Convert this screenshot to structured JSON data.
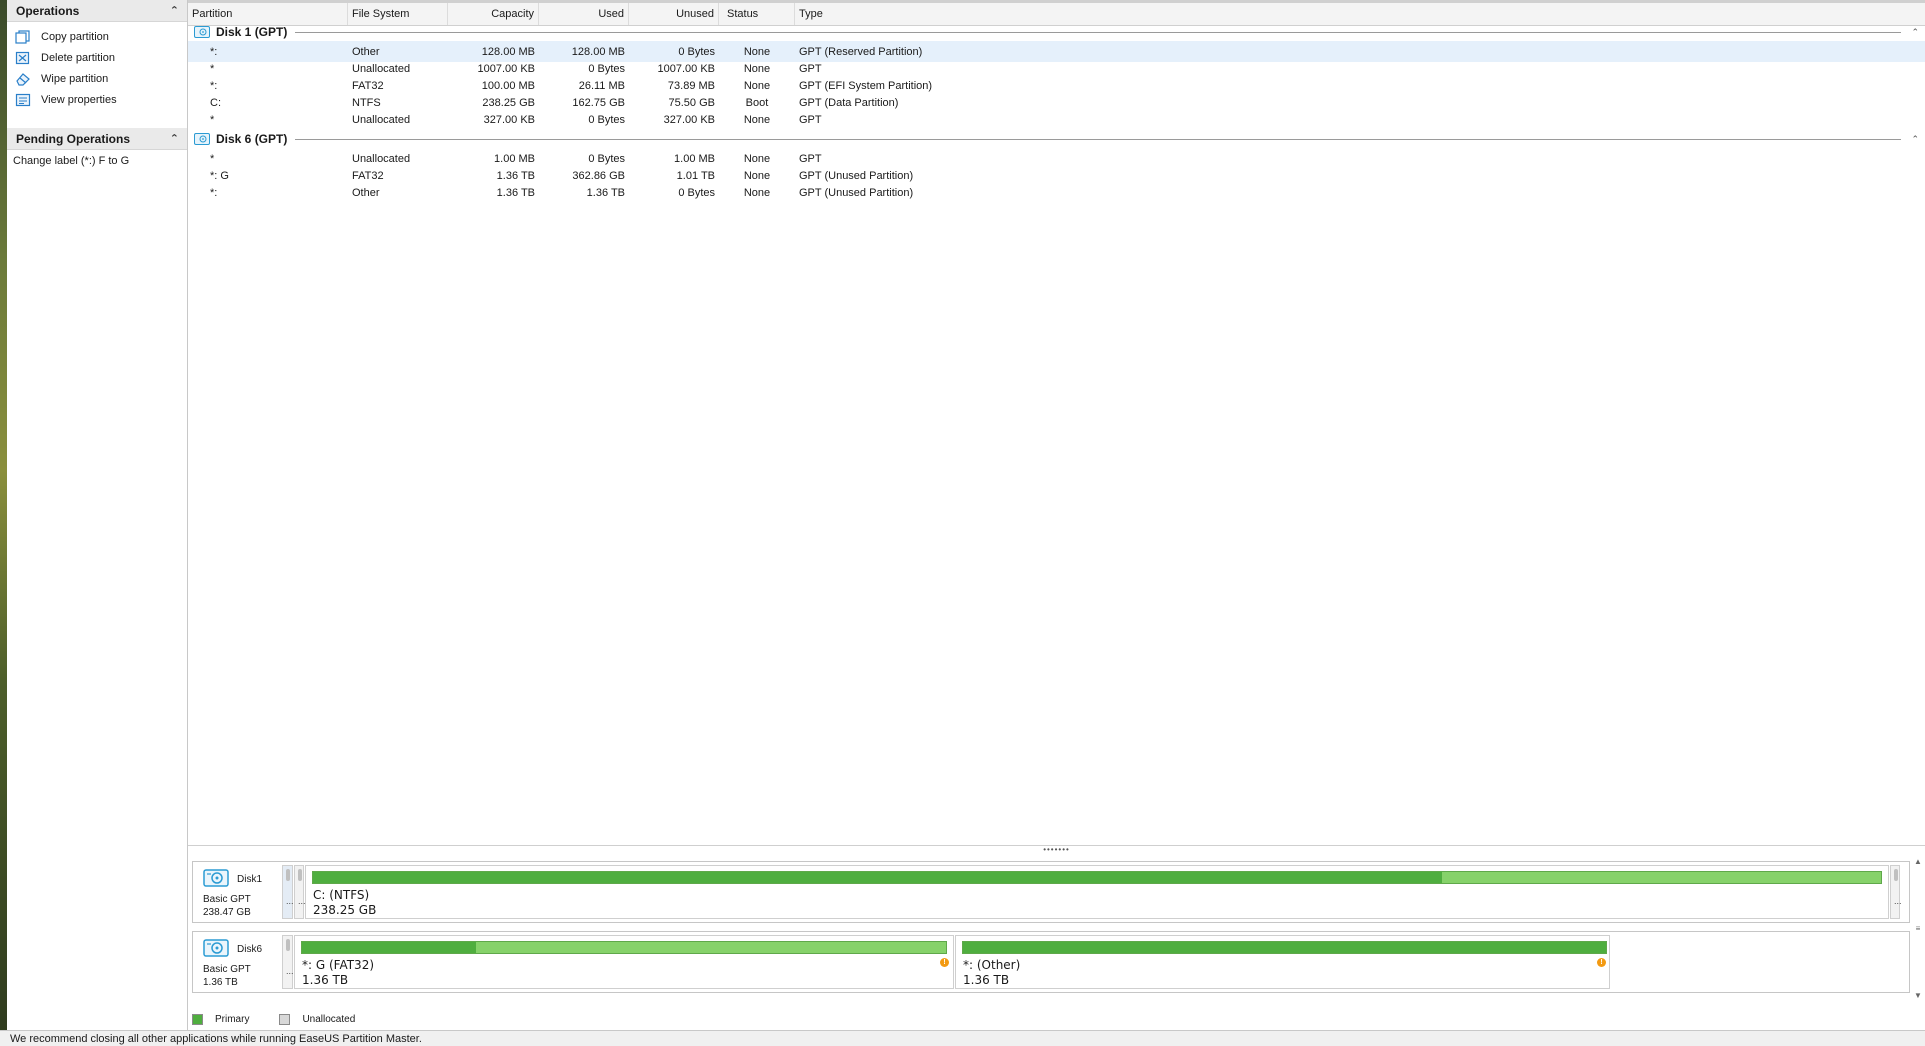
{
  "operations": {
    "title": "Operations",
    "items": [
      {
        "label": "Copy partition",
        "icon": "copy-icon"
      },
      {
        "label": "Delete partition",
        "icon": "delete-icon"
      },
      {
        "label": "Wipe partition",
        "icon": "eraser-icon"
      },
      {
        "label": "View properties",
        "icon": "properties-icon"
      }
    ]
  },
  "pending": {
    "title": "Pending Operations",
    "items": [
      {
        "label": "Change label (*:) F to G"
      }
    ]
  },
  "table": {
    "columns": [
      "Partition",
      "File System",
      "Capacity",
      "Used",
      "Unused",
      "Status",
      "Type"
    ],
    "groups": [
      {
        "name": "Disk 1 (GPT)",
        "rows": [
          {
            "partition": "*:",
            "fs": "Other",
            "capacity": "128.00 MB",
            "used": "128.00 MB",
            "unused": "0 Bytes",
            "status": "None",
            "type": "GPT (Reserved Partition)",
            "selected": true
          },
          {
            "partition": "*",
            "fs": "Unallocated",
            "capacity": "1007.00 KB",
            "used": "0 Bytes",
            "unused": "1007.00 KB",
            "status": "None",
            "type": "GPT"
          },
          {
            "partition": "*:",
            "fs": "FAT32",
            "capacity": "100.00 MB",
            "used": "26.11 MB",
            "unused": "73.89 MB",
            "status": "None",
            "type": "GPT (EFI System Partition)"
          },
          {
            "partition": "C:",
            "fs": "NTFS",
            "capacity": "238.25 GB",
            "used": "162.75 GB",
            "unused": "75.50 GB",
            "status": "Boot",
            "type": "GPT (Data Partition)"
          },
          {
            "partition": "*",
            "fs": "Unallocated",
            "capacity": "327.00 KB",
            "used": "0 Bytes",
            "unused": "327.00 KB",
            "status": "None",
            "type": "GPT"
          }
        ]
      },
      {
        "name": "Disk 6 (GPT)",
        "rows": [
          {
            "partition": "*",
            "fs": "Unallocated",
            "capacity": "1.00 MB",
            "used": "0 Bytes",
            "unused": "1.00 MB",
            "status": "None",
            "type": "GPT"
          },
          {
            "partition": "*: G",
            "fs": "FAT32",
            "capacity": "1.36 TB",
            "used": "362.86 GB",
            "unused": "1.01 TB",
            "status": "None",
            "type": "GPT (Unused Partition)"
          },
          {
            "partition": "*:",
            "fs": "Other",
            "capacity": "1.36 TB",
            "used": "1.36 TB",
            "unused": "0 Bytes",
            "status": "None",
            "type": "GPT (Unused Partition)"
          }
        ]
      }
    ]
  },
  "splitter": {
    "glyph": "•••••••"
  },
  "disk_maps": [
    {
      "name": "Disk1",
      "type": "Basic GPT",
      "size": "238.47 GB",
      "tiny_dots": "...",
      "partitions": [
        {
          "label": "C: (NTFS)",
          "size": "238.25 GB",
          "used_fraction": 0.72,
          "warning": false
        }
      ]
    },
    {
      "name": "Disk6",
      "type": "Basic GPT",
      "size": "1.36 TB",
      "tiny_dots": "...",
      "partitions": [
        {
          "label": "*: G (FAT32)",
          "size": "1.36 TB",
          "used_fraction": 0.27,
          "warning": true,
          "warning_glyph": "!"
        },
        {
          "label": "*: (Other)",
          "size": "1.36 TB",
          "used_fraction": 1.0,
          "warning": true,
          "warning_glyph": "!"
        }
      ]
    }
  ],
  "legend": [
    {
      "label": "Primary",
      "color": "#4fae3f"
    },
    {
      "label": "Unallocated",
      "color": "#d8d8d8"
    }
  ],
  "status_bar": "We recommend closing all other applications while running EaseUS Partition Master.",
  "colors": {
    "accent": "#4fae3f",
    "selection": "#e5f0fb"
  }
}
